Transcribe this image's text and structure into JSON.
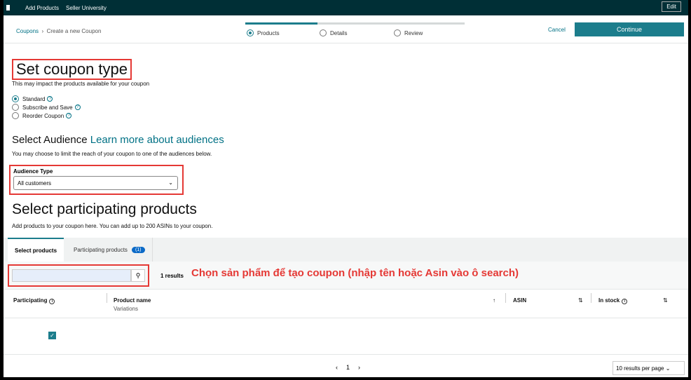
{
  "topbar": {
    "links": [
      "Add Products",
      "Seller University"
    ],
    "edit": "Edit"
  },
  "header": {
    "breadcrumb": [
      "Coupons",
      "Create a new Coupon"
    ],
    "steps": [
      "Products",
      "Details",
      "Review"
    ],
    "active_step": 0,
    "step_progress": 0.33,
    "cancel": "Cancel",
    "continue": "Continue"
  },
  "coupon_type": {
    "title": "Set coupon type",
    "subtitle": "This may impact the products available for your coupon",
    "options": [
      "Standard",
      "Subscribe and Save",
      "Reorder Coupon"
    ],
    "selected": "Standard"
  },
  "audience": {
    "title": "Select Audience",
    "link": "Learn more about audiences",
    "subtitle": "You may choose to limit the reach of your coupon to one of the audiences below.",
    "label": "Audience Type",
    "value": "All customers"
  },
  "products": {
    "title": "Select participating products",
    "subtitle": "Add products to your coupon here. You can add up to 200 ASINs to your coupon.",
    "tabs": [
      "Select products",
      "Participating products"
    ],
    "badge": "(1)",
    "search_value": "",
    "results": "1 results",
    "annotation": "Chọn sản phẩm để tạo coupon (nhập tên hoặc Asin vào ô search)",
    "columns": [
      "Participating",
      "Product name",
      "ASIN",
      "In stock"
    ],
    "subcolumn": "Variations",
    "row_checked": true,
    "page": "1",
    "per_page": "10 results per page"
  },
  "colors": {
    "accent": "#1c7d8c",
    "annotation": "#e53935",
    "topbar": "#002f36"
  }
}
